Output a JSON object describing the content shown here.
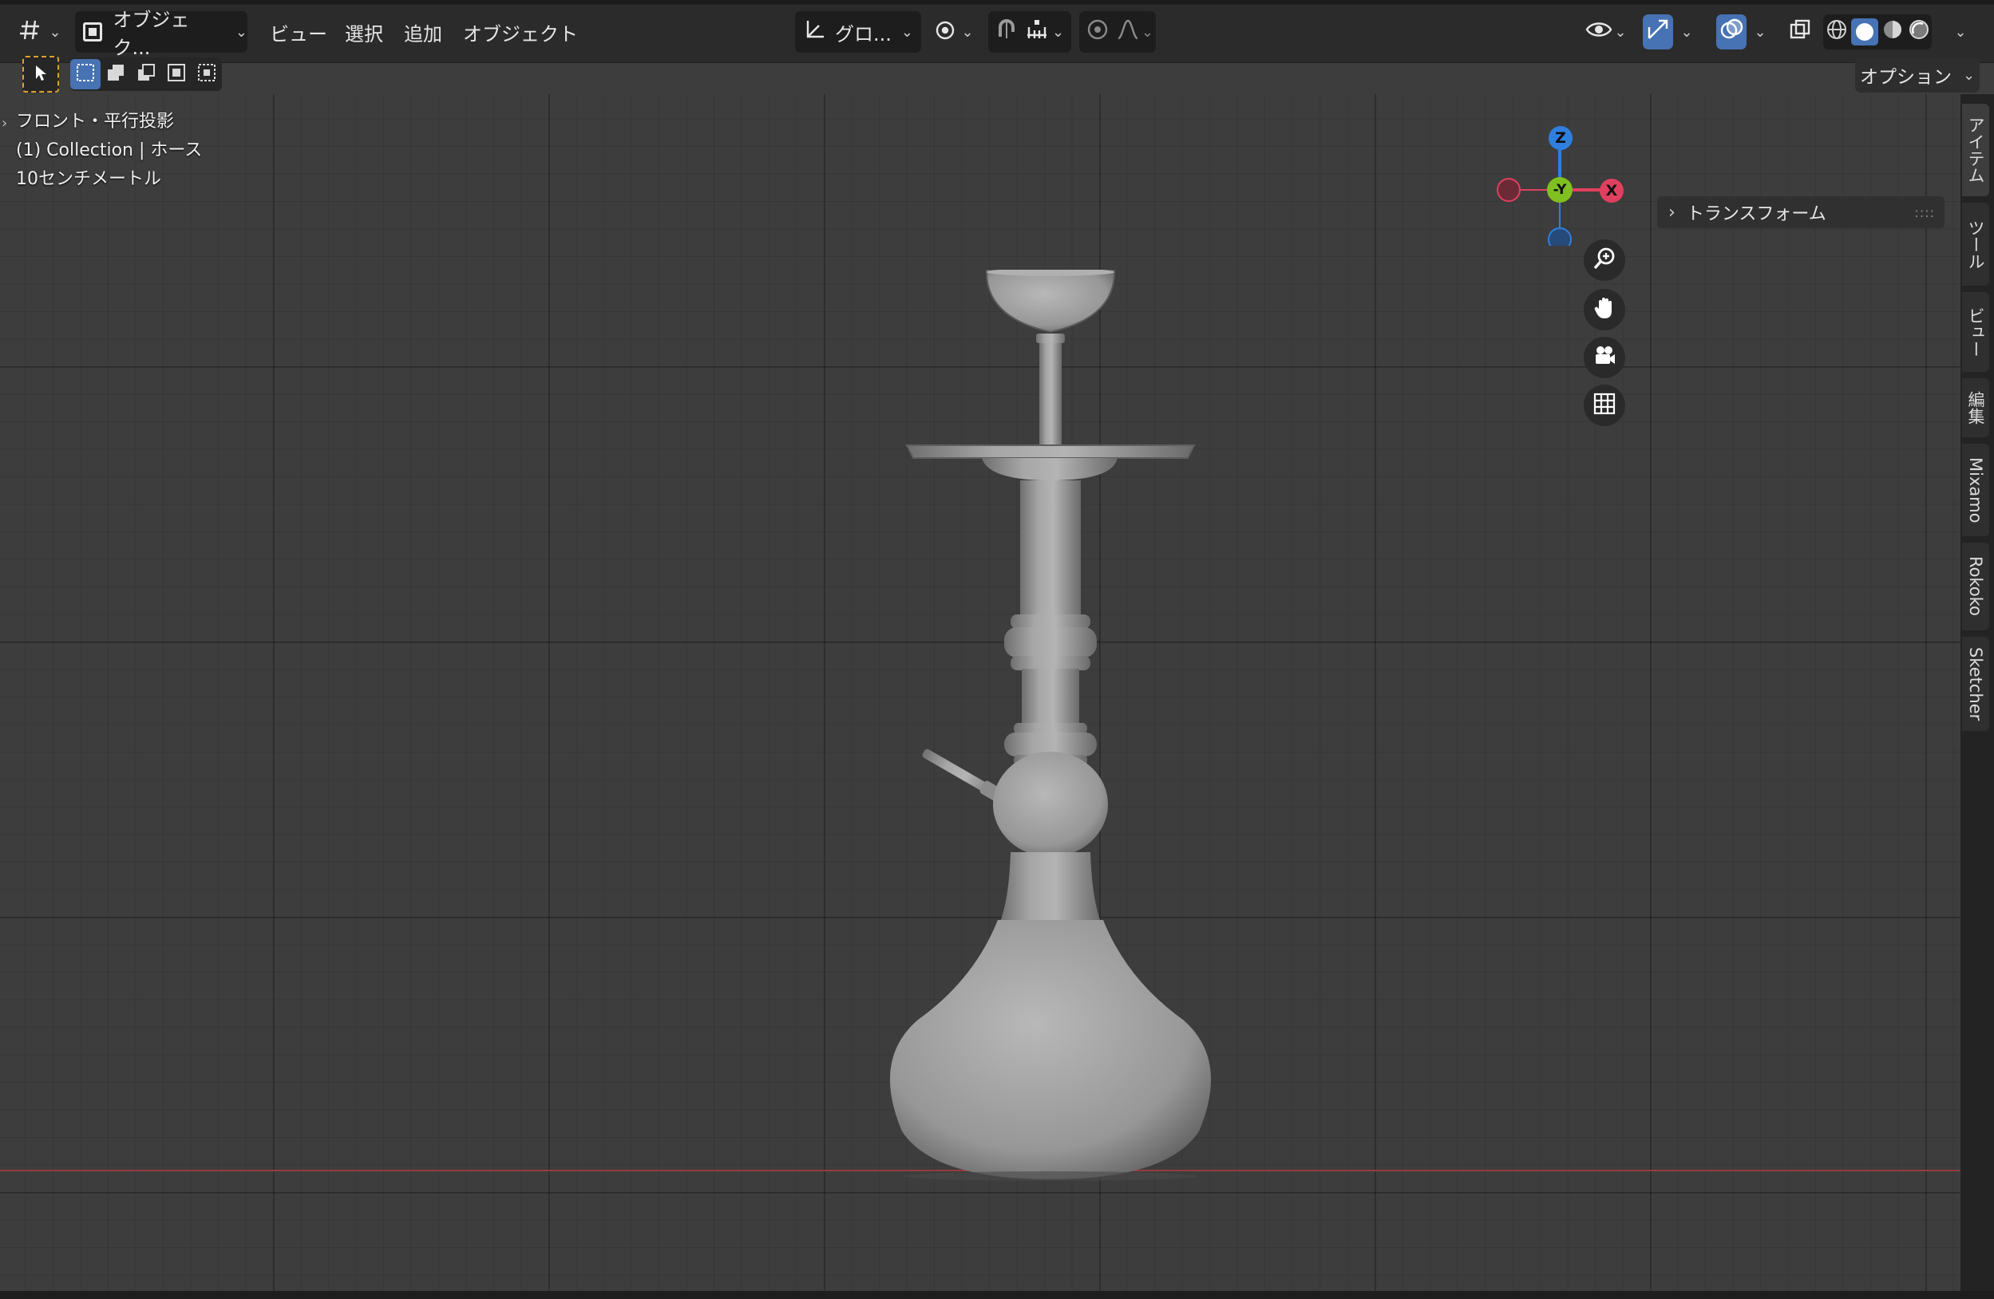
{
  "header": {
    "editor_type_icon": "viewport-editor-icon",
    "mode_label": "オブジェク...",
    "menus": [
      "ビュー",
      "選択",
      "追加",
      "オブジェクト"
    ],
    "transform_orientation": "グロ...",
    "pivot_icon": "pivot-icon",
    "snap_icon": "snap-magnet-icon",
    "proportional_icon": "proportional-edit-icon",
    "options_label": "オプション"
  },
  "viewport": {
    "view_name": "フロント・平行投影",
    "collection_line": "(1) Collection | ホース",
    "scale_line": "10センチメートル",
    "background_color": "#3d3d3d",
    "x_axis_color": "#9a3a40"
  },
  "gizmo": {
    "z_label": "Z",
    "y_label": "-Y",
    "x_label": "X",
    "z_color": "#2f7fe0",
    "y_color": "#80c020",
    "x_color": "#e04060"
  },
  "npanel": {
    "section_label": "トランスフォーム",
    "tabs": [
      "アイテム",
      "ツール",
      "ビュー",
      "編集",
      "Mixamo",
      "Rokoko",
      "Sketcher"
    ]
  },
  "object": {
    "name": "ホース",
    "color": "#9a9a9a"
  }
}
